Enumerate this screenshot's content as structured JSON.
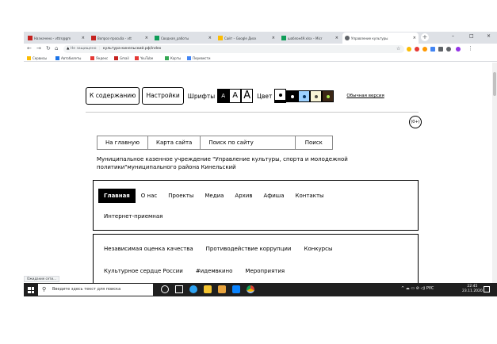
{
  "browser": {
    "tabs": [
      {
        "label": "Назначено - vttrs@gm",
        "active": false,
        "icon_color": "#c5221f"
      },
      {
        "label": "Вопрос-просьба - vtt",
        "active": false,
        "icon_color": "#c5221f"
      },
      {
        "label": "Сводная_работы",
        "active": false,
        "icon_color": "#0f9d58"
      },
      {
        "label": "Сайт – Google Диск",
        "active": false,
        "icon_color": "#fbbc04"
      },
      {
        "label": "шаблон49.xlsx – Micr",
        "active": false,
        "icon_color": "#0f9d58"
      },
      {
        "label": "Управление культуры",
        "active": true,
        "icon_color": "#5f6368"
      }
    ],
    "new_tab_label": "+",
    "window_controls": [
      "–",
      "□",
      "×"
    ],
    "address": {
      "security_text": "Не защищено",
      "url": "культура-кинельский.рф/index"
    },
    "bookmarks": [
      {
        "label": "Сервисы",
        "icon_color": "#fbbc04"
      },
      {
        "label": "Автобилеты",
        "icon_color": "#1a73e8"
      },
      {
        "label": "Яндекс",
        "icon_color": "#e53935"
      },
      {
        "label": "Gmail",
        "icon_color": "#c5221f"
      },
      {
        "label": "YouTube",
        "icon_color": "#e53935"
      },
      {
        "label": "Карты",
        "icon_color": "#34a853"
      },
      {
        "label": "Перевести",
        "icon_color": "#4285f4"
      }
    ],
    "status_text": "Ожидание сети..."
  },
  "page": {
    "accessibility": {
      "contents_label": "К содержанию",
      "settings_label": "Настройки",
      "fonts_label": "Шрифты",
      "font_sizes": [
        "A",
        "A",
        "A"
      ],
      "color_label": "Цвет",
      "color_schemes": [
        {
          "bg": "#ffffff",
          "dot": "#000000"
        },
        {
          "bg": "#000000",
          "dot": "#ffffff"
        },
        {
          "bg": "#9dd1ff",
          "dot": "#063462"
        },
        {
          "bg": "#f7f3d6",
          "dot": "#4d4b43"
        },
        {
          "bg": "#3b2716",
          "dot": "#a9e44d"
        }
      ],
      "old_version_label": "Обычная версия",
      "zoom_label": "(0+)"
    },
    "top_links": [
      "На главную",
      "Карта сайта",
      "Поиск по сайту",
      "Поиск"
    ],
    "org_name": "Муниципальное казенное учреждение \"Управление культуры, спорта и молодежной политики\"муниципального района Кинельский",
    "menu": [
      "Главная",
      "О нас",
      "Проекты",
      "Медиа",
      "Архив",
      "Афиша",
      "Контакты"
    ],
    "menu_extra": "Интернет-приемная",
    "submenu_row1": [
      "Независимая оценка качества",
      "Противодействие коррупции",
      "Конкурсы"
    ],
    "submenu_row2": [
      "Культурное сердце России",
      "#идемвкино",
      "Мероприятия"
    ]
  },
  "taskbar": {
    "search_placeholder": "Введите здесь текст для поиска",
    "apps": [
      {
        "name": "cortana",
        "color": "#ffffff"
      },
      {
        "name": "task-view",
        "color": "#ffffff"
      },
      {
        "name": "edge",
        "color": "#2ea3f2"
      },
      {
        "name": "explorer",
        "color": "#f4c430"
      },
      {
        "name": "store",
        "color": "#e8a33d"
      },
      {
        "name": "mail",
        "color": "#0a84ff"
      },
      {
        "name": "chrome",
        "color": "#f4b400"
      }
    ],
    "tray_text": "^ ☁ ▭ ⊘ ◁) РУС",
    "time": "22:45",
    "date": "23.11.2020"
  }
}
